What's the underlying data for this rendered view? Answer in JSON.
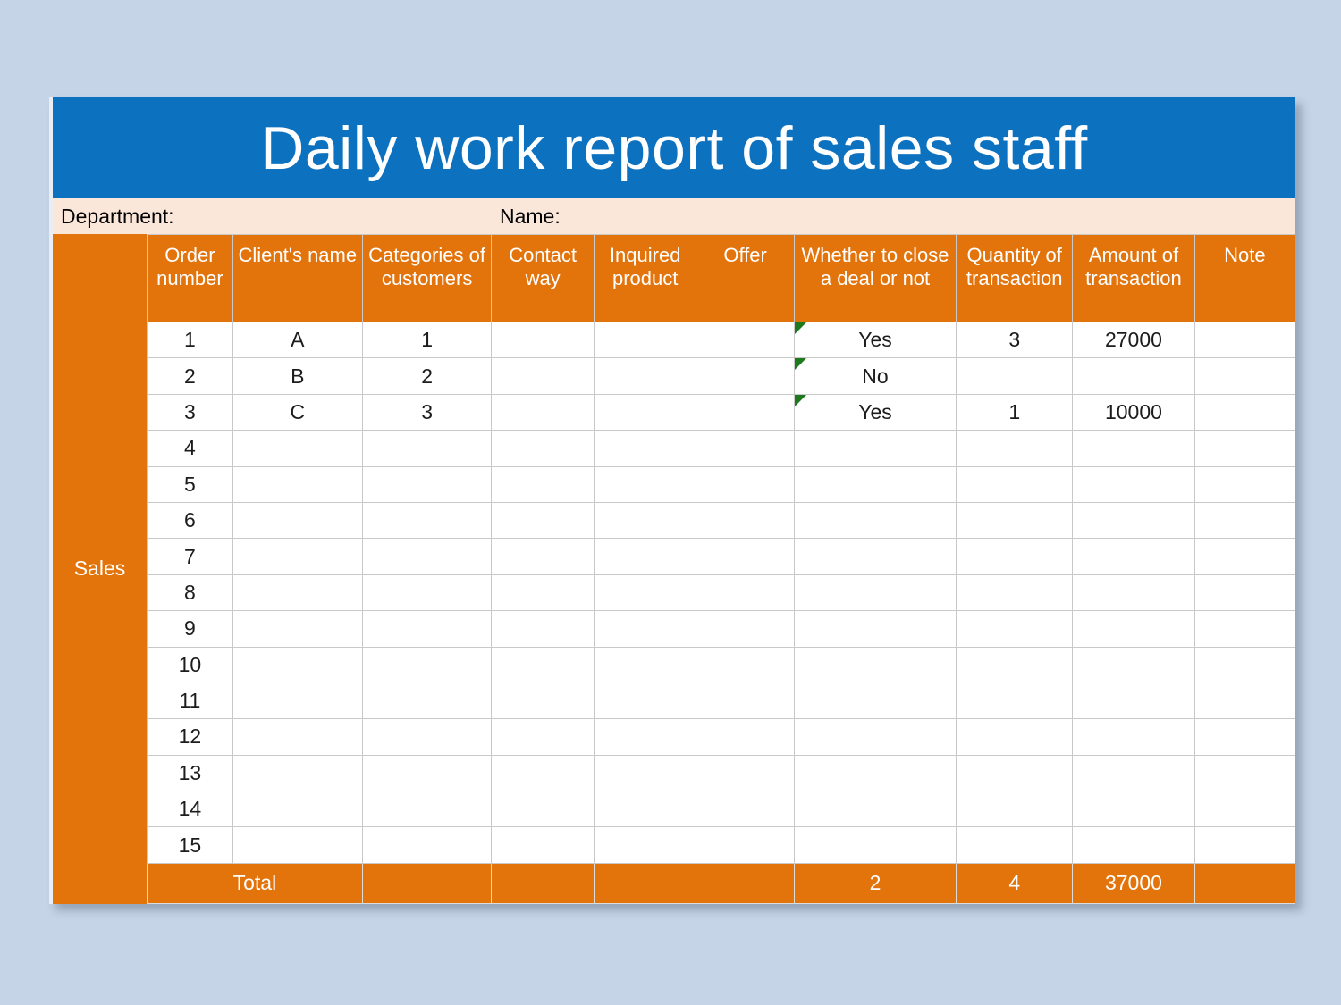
{
  "title": "Daily work report of sales staff",
  "info": {
    "department_label": "Department:",
    "name_label": "Name:"
  },
  "side": {
    "label": "Sales"
  },
  "table": {
    "headers": [
      "Order number",
      "Client's name",
      "Categories of customers",
      "Contact way",
      "Inquired product",
      "Offer",
      "Whether to close a deal or not",
      "Quantity of transaction",
      "Amount of transaction",
      "Note"
    ],
    "rows": [
      {
        "order": "1",
        "client": "A",
        "category": "1",
        "contact": "",
        "inquired": "",
        "offer": "",
        "deal": "Yes",
        "quantity": "3",
        "amount": "27000",
        "note": "",
        "flag": true
      },
      {
        "order": "2",
        "client": "B",
        "category": "2",
        "contact": "",
        "inquired": "",
        "offer": "",
        "deal": "No",
        "quantity": "",
        "amount": "",
        "note": "",
        "flag": true
      },
      {
        "order": "3",
        "client": "C",
        "category": "3",
        "contact": "",
        "inquired": "",
        "offer": "",
        "deal": "Yes",
        "quantity": "1",
        "amount": "10000",
        "note": "",
        "flag": true
      },
      {
        "order": "4",
        "client": "",
        "category": "",
        "contact": "",
        "inquired": "",
        "offer": "",
        "deal": "",
        "quantity": "",
        "amount": "",
        "note": "",
        "flag": false
      },
      {
        "order": "5",
        "client": "",
        "category": "",
        "contact": "",
        "inquired": "",
        "offer": "",
        "deal": "",
        "quantity": "",
        "amount": "",
        "note": "",
        "flag": false
      },
      {
        "order": "6",
        "client": "",
        "category": "",
        "contact": "",
        "inquired": "",
        "offer": "",
        "deal": "",
        "quantity": "",
        "amount": "",
        "note": "",
        "flag": false
      },
      {
        "order": "7",
        "client": "",
        "category": "",
        "contact": "",
        "inquired": "",
        "offer": "",
        "deal": "",
        "quantity": "",
        "amount": "",
        "note": "",
        "flag": false
      },
      {
        "order": "8",
        "client": "",
        "category": "",
        "contact": "",
        "inquired": "",
        "offer": "",
        "deal": "",
        "quantity": "",
        "amount": "",
        "note": "",
        "flag": false
      },
      {
        "order": "9",
        "client": "",
        "category": "",
        "contact": "",
        "inquired": "",
        "offer": "",
        "deal": "",
        "quantity": "",
        "amount": "",
        "note": "",
        "flag": false
      },
      {
        "order": "10",
        "client": "",
        "category": "",
        "contact": "",
        "inquired": "",
        "offer": "",
        "deal": "",
        "quantity": "",
        "amount": "",
        "note": "",
        "flag": false
      },
      {
        "order": "11",
        "client": "",
        "category": "",
        "contact": "",
        "inquired": "",
        "offer": "",
        "deal": "",
        "quantity": "",
        "amount": "",
        "note": "",
        "flag": false
      },
      {
        "order": "12",
        "client": "",
        "category": "",
        "contact": "",
        "inquired": "",
        "offer": "",
        "deal": "",
        "quantity": "",
        "amount": "",
        "note": "",
        "flag": false
      },
      {
        "order": "13",
        "client": "",
        "category": "",
        "contact": "",
        "inquired": "",
        "offer": "",
        "deal": "",
        "quantity": "",
        "amount": "",
        "note": "",
        "flag": false
      },
      {
        "order": "14",
        "client": "",
        "category": "",
        "contact": "",
        "inquired": "",
        "offer": "",
        "deal": "",
        "quantity": "",
        "amount": "",
        "note": "",
        "flag": false
      },
      {
        "order": "15",
        "client": "",
        "category": "",
        "contact": "",
        "inquired": "",
        "offer": "",
        "deal": "",
        "quantity": "",
        "amount": "",
        "note": "",
        "flag": false
      }
    ],
    "total": {
      "label": "Total",
      "contact": "",
      "inquired": "",
      "offer": "",
      "deal": "2",
      "quantity": "4",
      "amount": "37000",
      "note": ""
    }
  },
  "colors": {
    "title_banner": "#0c72c0",
    "accent_orange": "#e3740c",
    "info_band": "#fbe6da",
    "page_background": "#c5d4e6",
    "flag_green": "#1f7a1f",
    "gridline": "#c9c9c9"
  }
}
